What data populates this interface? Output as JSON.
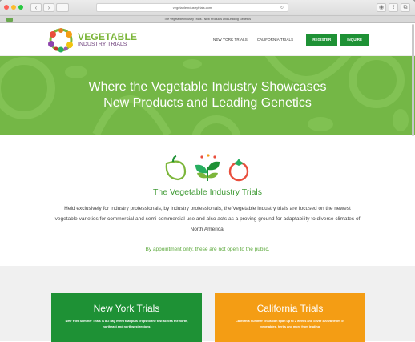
{
  "browser": {
    "url": "vegetableindustrytrials.com",
    "tab_title": "The Vegetable Industry Trials - New Products and Leading Genetics",
    "reload_icon": "reload-icon"
  },
  "site": {
    "logo_line1": "VEGETABLE",
    "logo_line2": "INDUSTRY TRIALS",
    "nav": {
      "new_york": "NEW YORK TRIALS",
      "california": "CALIFORNIA TRIALS",
      "register": "REGISTER",
      "inquire": "INQUIRE"
    }
  },
  "hero": {
    "line1": "Where the Vegetable Industry Showcases",
    "line2": "New Products and Leading Genetics"
  },
  "intro": {
    "heading": "The Vegetable Industry Trials",
    "description": "Held exclusively for industry professionals, by industry professionals, the Vegetable Industry trials are focused on the newest vegetable varieties for commercial and semi-commercial use and also acts as a proving ground for adaptability to diverse climates of North America.",
    "note": "By appointment only, these are not open to the public."
  },
  "cards": [
    {
      "title": "New York Trials",
      "text": "New York Summer Trials is a 2 day event that puts crops to the test across the north, northeast and northwest regions"
    },
    {
      "title": "California Trials",
      "text": "California Summer Trials can span up to 2 weeks and cover 400 varieties of vegetables, herbs and more from leading"
    }
  ],
  "colors": {
    "brand_green": "#1e9135",
    "hero_green": "#74b746",
    "accent_orange": "#f49d14",
    "logo_purple": "#6c3d7a"
  }
}
